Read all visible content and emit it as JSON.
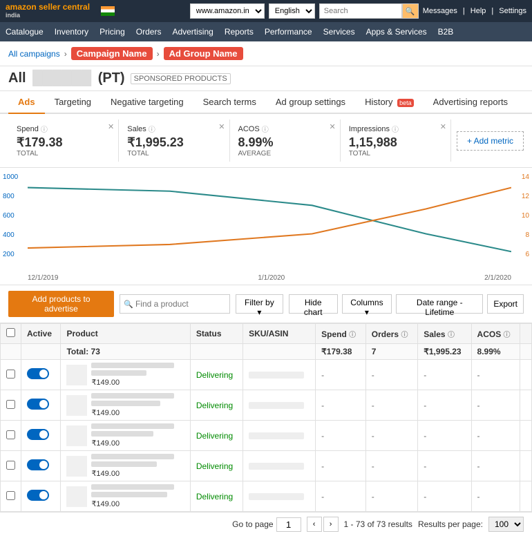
{
  "topNav": {
    "logo": "amazon seller central",
    "logoSub": "india",
    "urlValue": "www.amazon.in",
    "lang": "English",
    "searchPlaceholder": "Search",
    "links": [
      "Messages",
      "Help",
      "Settings"
    ]
  },
  "menuBar": {
    "items": [
      "Catalogue",
      "Inventory",
      "Pricing",
      "Orders",
      "Advertising",
      "Reports",
      "Performance",
      "Services",
      "Apps & Services",
      "B2B"
    ]
  },
  "breadcrumb": {
    "allCampaigns": "All campaigns",
    "campaignName": "Campaign Name",
    "adGroupName": "Ad Group Name"
  },
  "pageTitle": {
    "prefix": "All",
    "blurred": "██████",
    "suffix": "(PT)",
    "sponsored": "SPONSORED PRODUCTS"
  },
  "tabs": {
    "items": [
      "Ads",
      "Targeting",
      "Negative targeting",
      "Search terms",
      "Ad group settings",
      "History",
      "Advertising reports"
    ],
    "historyBadge": "beta",
    "activeTab": "Ads"
  },
  "metrics": {
    "spend": {
      "label": "Spend",
      "value": "₹179.38",
      "sub": "TOTAL"
    },
    "sales": {
      "label": "Sales",
      "value": "₹1,995.23",
      "sub": "TOTAL"
    },
    "acos": {
      "label": "ACOS",
      "value": "8.99%",
      "sub": "AVERAGE"
    },
    "impressions": {
      "label": "Impressions",
      "value": "1,15,988",
      "sub": "TOTAL"
    },
    "addMetric": "+ Add metric"
  },
  "chart": {
    "yLeftLabels": [
      "1000",
      "800",
      "600",
      "400",
      "200"
    ],
    "yRightLabels": [
      "14",
      "12",
      "10",
      "8",
      "6"
    ],
    "xLabels": [
      "12/1/2019",
      "1/1/2020",
      "2/1/2020"
    ]
  },
  "toolbar": {
    "addProducts": "Add products to advertise",
    "searchPlaceholder": "Find a product",
    "filterBy": "Filter by",
    "hideChart": "Hide chart",
    "columns": "Columns",
    "dateRange": "Date range - Lifetime",
    "export": "Export"
  },
  "table": {
    "headers": [
      "",
      "Active",
      "Product",
      "Status",
      "SKU/ASIN",
      "Spend",
      "Orders",
      "Sales",
      "ACOS"
    ],
    "totalRow": {
      "label": "Total: 73",
      "spend": "₹179.38",
      "orders": "7",
      "sales": "₹1,995.23",
      "acos": "8.99%"
    },
    "rows": [
      {
        "status": "Delivering",
        "price": "₹149.00",
        "spend": "-",
        "orders": "-",
        "sales": "-",
        "acos": "-"
      },
      {
        "status": "Delivering",
        "price": "₹149.00",
        "spend": "-",
        "orders": "-",
        "sales": "-",
        "acos": "-"
      },
      {
        "status": "Delivering",
        "price": "₹149.00",
        "spend": "-",
        "orders": "-",
        "sales": "-",
        "acos": "-"
      },
      {
        "status": "Delivering",
        "price": "₹149.00",
        "spend": "-",
        "orders": "-",
        "sales": "-",
        "acos": "-"
      },
      {
        "status": "Delivering",
        "price": "₹149.00",
        "spend": "-",
        "orders": "-",
        "sales": "-",
        "acos": "-"
      }
    ]
  },
  "footer": {
    "gotoPage": "Go to page",
    "pageValue": "1",
    "resultsInfo": "1 - 73 of 73 results",
    "perPage": "Results per page:",
    "perPageValue": "100"
  }
}
